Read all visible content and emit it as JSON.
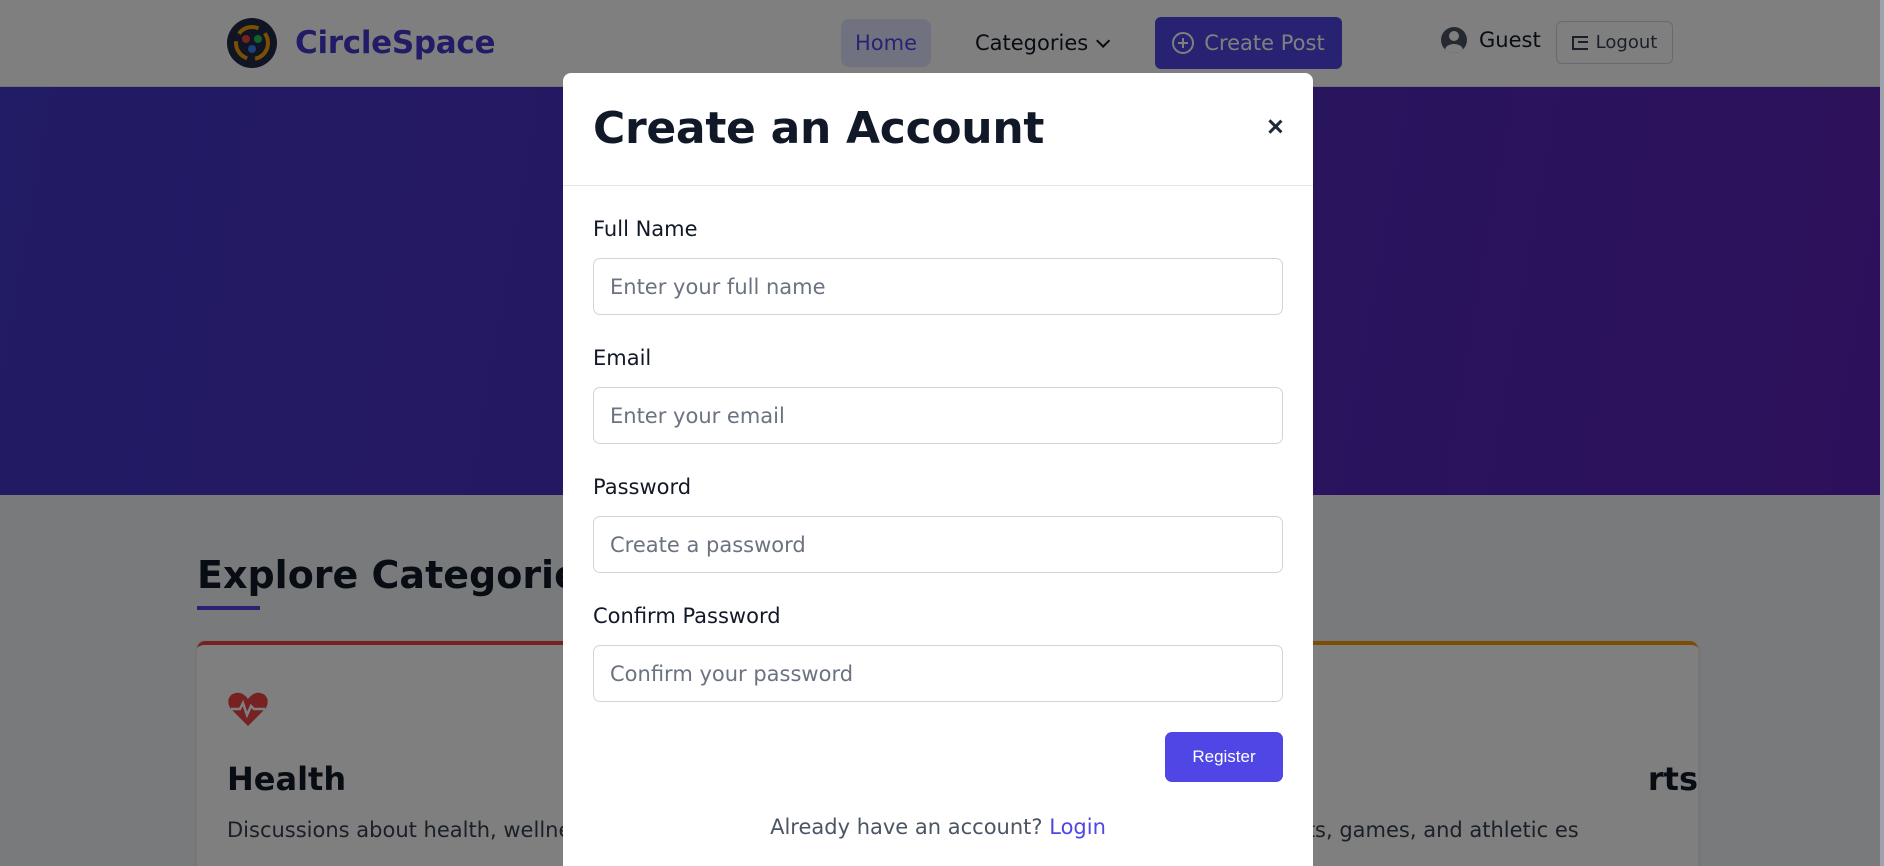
{
  "navbar": {
    "brand": "CircleSpace",
    "home_label": "Home",
    "categories_label": "Categories",
    "create_post_label": "Create Post",
    "user_label": "Guest",
    "logout_label": "Logout"
  },
  "section": {
    "title": "Explore Categories"
  },
  "cards": [
    {
      "title": "Health",
      "description": "Discussions about health, wellness, fitness",
      "icon": "heart-pulse-icon",
      "accent": "#ef4444"
    },
    {
      "title": "rts",
      "description": "out sports, games, and athletic es",
      "accent": "#f59e0b"
    }
  ],
  "modal": {
    "title": "Create an Account",
    "fields": [
      {
        "label": "Full Name",
        "placeholder": "Enter your full name",
        "value": ""
      },
      {
        "label": "Email",
        "placeholder": "Enter your email",
        "value": ""
      },
      {
        "label": "Password",
        "placeholder": "Create a password",
        "value": ""
      },
      {
        "label": "Confirm Password",
        "placeholder": "Confirm your password",
        "value": ""
      }
    ],
    "register_label": "Register",
    "footer_prompt": "Already have an account?",
    "login_label": "Login"
  },
  "colors": {
    "primary": "#4f46e5",
    "brand": "#4338ca",
    "hero_start": "#4338ca",
    "hero_end": "#5b21b6"
  }
}
